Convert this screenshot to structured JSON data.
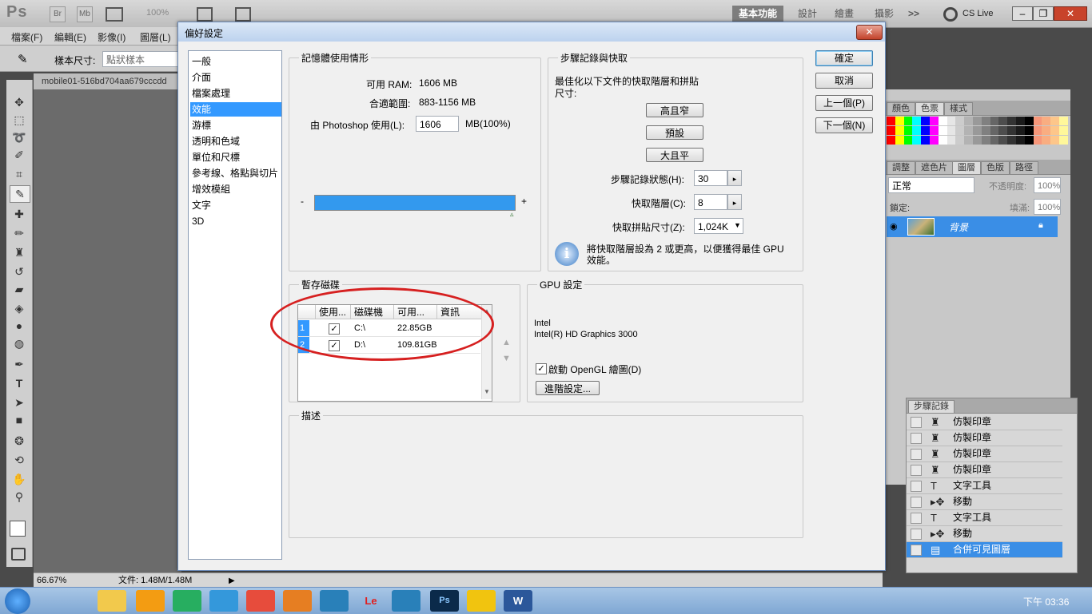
{
  "app": {
    "logo": "Ps",
    "bridge_btn": "Br",
    "minibridge_btn": "Mb",
    "zoom": "100%",
    "workspaces": [
      "基本功能",
      "設計",
      "繪畫",
      "攝影"
    ],
    "more": ">>",
    "cslive": "CS Live"
  },
  "menubar": [
    "檔案(F)",
    "編輯(E)",
    "影像(I)",
    "圖層(L)"
  ],
  "options": {
    "sample_label": "樣本尺寸:",
    "sample_value": "點狀樣本"
  },
  "document": {
    "tab": "mobile01-516bd704aa679cccdd",
    "zoom": "66.67%",
    "file_info": "文件: 1.48M/1.48M"
  },
  "dialog": {
    "title": "偏好設定",
    "close": "✕",
    "categories": [
      "一般",
      "介面",
      "檔案處理",
      "效能",
      "游標",
      "透明和色域",
      "單位和尺標",
      "參考線、格點與切片",
      "增效模組",
      "文字",
      "3D"
    ],
    "selected_category": "效能",
    "buttons": {
      "ok": "確定",
      "cancel": "取消",
      "prev": "上一個(P)",
      "next": "下一個(N)"
    },
    "memory": {
      "legend": "記憶體使用情形",
      "available_label": "可用 RAM:",
      "available_value": "1606 MB",
      "ideal_label": "合適範圍:",
      "ideal_value": "883-1156 MB",
      "use_label": "由 Photoshop 使用(L):",
      "use_value": "1606",
      "use_unit": "MB(100%)",
      "minus": "-",
      "plus": "+",
      "slider_fraction": 1.0
    },
    "history_cache": {
      "legend": "步驟記錄與快取",
      "desc": "最佳化以下文件的快取階層和拼貼尺寸:",
      "btn_tall": "高且窄",
      "btn_default": "預設",
      "btn_big": "大且平",
      "states_label": "步驟記錄狀態(H):",
      "states_value": "30",
      "levels_label": "快取階層(C):",
      "levels_value": "8",
      "tile_label": "快取拼貼尺寸(Z):",
      "tile_value": "1,024K",
      "info": "將快取階層設為 2 或更高，以便獲得最佳 GPU 效能。"
    },
    "scratch": {
      "legend": "暫存磁碟",
      "headers": [
        "使用...",
        "磁碟機",
        "可用...",
        "資訊"
      ],
      "rows": [
        {
          "num": "1",
          "active": true,
          "drive": "C:\\",
          "free": "22.85GB"
        },
        {
          "num": "2",
          "active": true,
          "drive": "D:\\",
          "free": "109.81GB"
        }
      ]
    },
    "gpu": {
      "legend": "GPU 設定",
      "vendor": "Intel",
      "model": "Intel(R) HD Graphics 3000",
      "opengl_label": "啟動 OpenGL 繪圖(D)",
      "opengl_checked": true,
      "advanced": "進階設定..."
    },
    "description": {
      "legend": "描述"
    }
  },
  "panels": {
    "top_tabs": [
      "顏色",
      "色票",
      "樣式"
    ],
    "layer_tabs": [
      "調整",
      "遮色片",
      "圖層",
      "色版",
      "路徑"
    ],
    "blend_mode": "正常",
    "opacity_label": "不透明度:",
    "opacity_value": "100%",
    "lock_label": "鎖定:",
    "fill_label": "填滿:",
    "fill_value": "100%",
    "layer_name": "背景",
    "swatch_colors": [
      "#ff0000",
      "#ffff00",
      "#00ff00",
      "#00ffff",
      "#0000ff",
      "#ff00ff",
      "#ffffff",
      "#e6e6e6",
      "#cccccc",
      "#b3b3b3",
      "#999999",
      "#808080",
      "#666666",
      "#4d4d4d",
      "#333333",
      "#1a1a1a",
      "#000000",
      "#f7977a",
      "#f9ad81",
      "#fdc68a",
      "#fff79a"
    ],
    "history_title": "步驟記錄",
    "history": [
      {
        "icon": "stamp",
        "label": "仿製印章"
      },
      {
        "icon": "stamp",
        "label": "仿製印章"
      },
      {
        "icon": "stamp",
        "label": "仿製印章"
      },
      {
        "icon": "stamp",
        "label": "仿製印章"
      },
      {
        "icon": "type",
        "label": "文字工具"
      },
      {
        "icon": "move",
        "label": "移動"
      },
      {
        "icon": "type",
        "label": "文字工具"
      },
      {
        "icon": "move",
        "label": "移動"
      },
      {
        "icon": "merge",
        "label": "合併可見圖層"
      }
    ]
  },
  "taskbar": {
    "clock": "下午 03:36",
    "apps": [
      "Le",
      "Ps",
      "W"
    ]
  }
}
